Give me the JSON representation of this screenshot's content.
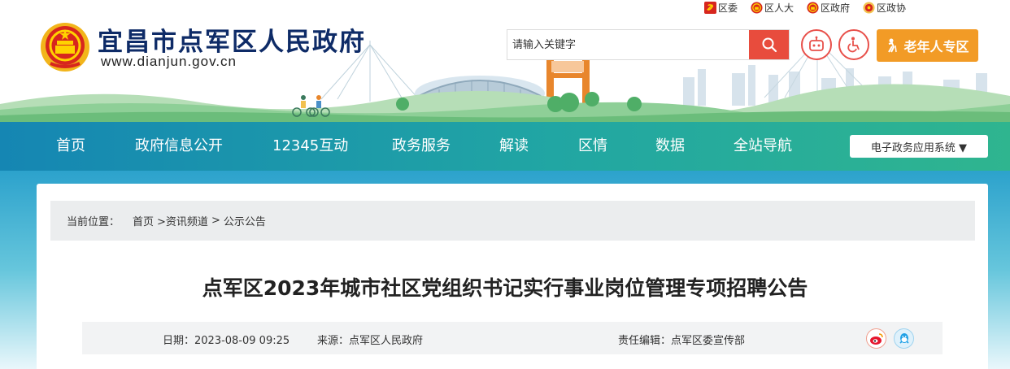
{
  "top_links": [
    {
      "label": "区委",
      "icon": "party-emblem-icon"
    },
    {
      "label": "区人大",
      "icon": "national-emblem-icon"
    },
    {
      "label": "区政府",
      "icon": "national-emblem-icon"
    },
    {
      "label": "区政协",
      "icon": "cppcc-emblem-icon"
    }
  ],
  "site": {
    "title": "宜昌市点军区人民政府",
    "url": "www.dianjun.gov.cn"
  },
  "search": {
    "placeholder": "请输入关键字",
    "icon": "search-icon"
  },
  "header_buttons": {
    "robot_icon": "robot-icon",
    "accessibility_icon": "wheelchair-icon",
    "elder_label": "老年人专区",
    "elder_icon": "elder-icon"
  },
  "colors": {
    "nav_gradient_start": "#1586b3",
    "nav_gradient_end": "#2fb58f",
    "search_button": "#e84c3d",
    "elder_button": "#f29b26",
    "title_blue": "#0e2b67",
    "accent_red": "#e8504a"
  },
  "nav": {
    "items": [
      "首页",
      "政府信息公开",
      "12345互动",
      "政务服务",
      "解读",
      "区情",
      "数据",
      "全站导航"
    ],
    "select_label": "电子政务应用系统 ▼"
  },
  "breadcrumb": {
    "label": "当前位置：",
    "items": [
      "首页",
      ">资讯频道",
      ">",
      "公示公告"
    ]
  },
  "article": {
    "title": "点军区2023年城市社区党组织书记实行事业岗位管理专项招聘公告",
    "date": "日期：2023-08-09 09:25",
    "source": "来源：点军区人民政府",
    "editor": "责任编辑：点军区委宣传部",
    "share_icons": [
      "weibo-icon",
      "qq-icon"
    ]
  }
}
